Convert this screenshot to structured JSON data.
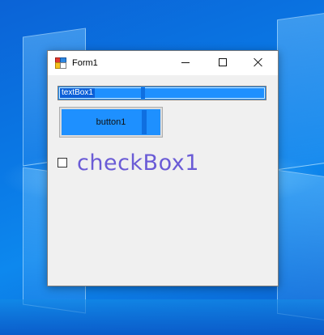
{
  "window": {
    "title": "Form1"
  },
  "controls": {
    "minimize_icon": "minimize-icon",
    "maximize_icon": "maximize-icon",
    "close_icon": "close-icon"
  },
  "form": {
    "textbox_value": "textBox1",
    "button_label": "button1",
    "checkbox_label": "checkBox1",
    "checkbox_checked": false
  },
  "colors": {
    "control_fill": "#1e90ff",
    "selection": "#0a5fd8",
    "checkbox_text": "#6a5bd6",
    "form_background": "#f0f0f0"
  }
}
